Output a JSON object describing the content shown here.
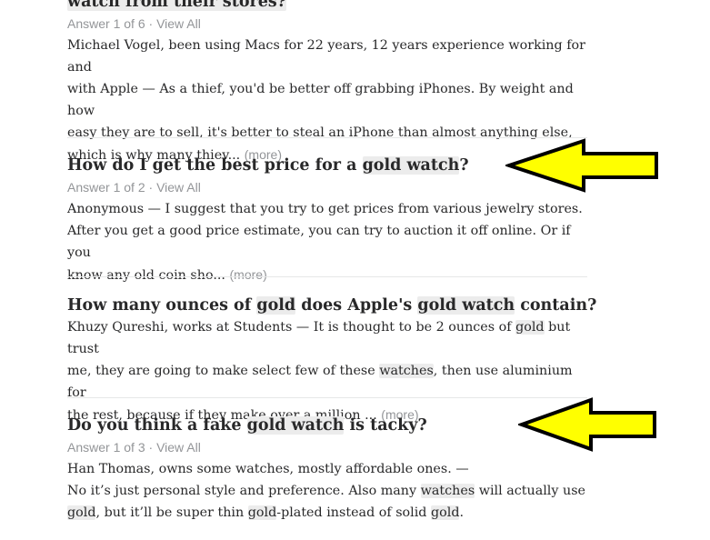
{
  "results": [
    {
      "title_tail": "watch from their stores?",
      "meta": {
        "answer": "Answer 1 of 6",
        "sep": " · ",
        "view_all": "View All"
      },
      "body": [
        "Michael Vogel, been using Macs for 22 years, 12 years experience working for and",
        "with Apple — As a thief, you'd be better off grabbing iPhones. By weight and how",
        "easy they are to sell, it's better to steal an iPhone than almost anything else,",
        "which is why many thiev..."
      ],
      "more": "(more)"
    },
    {
      "title": {
        "pre": "How do I get the best price for a ",
        "hl": "gold watch",
        "post": "?"
      },
      "meta": {
        "answer": "Answer 1 of 2",
        "sep": " · ",
        "view_all": "View All"
      },
      "body": [
        "Anonymous — I suggest that you try to get prices from various jewelry stores.",
        "After you get a good price estimate, you can try to auction it off online. Or if you",
        "know any old coin sho..."
      ],
      "more": "(more)"
    },
    {
      "title": {
        "a": "How many ounces of ",
        "hl1": "gold",
        "b": " does Apple's ",
        "hl2": "gold watch",
        "c": " contain?"
      },
      "body": {
        "l1a": "Khuzy Qureshi, works at Students — It is thought to be 2 ounces of ",
        "l1hl": "gold",
        "l1b": " but trust",
        "l2a": "me, they are going to make select few of these ",
        "l2hl": "watches",
        "l2b": ", then use aluminium for",
        "l3": "the rest, because if they make over a million ..."
      },
      "more": "(more)"
    },
    {
      "title": {
        "pre": "Do you think a fake ",
        "hl": "gold watch",
        "post": " is tacky?"
      },
      "meta": {
        "answer": "Answer 1 of 3",
        "sep": " · ",
        "view_all": "View All"
      },
      "body": {
        "l1": "Han Thomas, owns some watches, mostly affordable ones. —",
        "l2a": "No it’s just personal style and preference. Also many ",
        "l2hl": "watches",
        "l2b": " will actually use",
        "l3hl1": "gold",
        "l3a": ", but it’ll be super thin ",
        "l3hl2": "gold",
        "l3b": "-plated instead of solid ",
        "l3hl3": "gold",
        "l3c": "."
      }
    }
  ],
  "colors": {
    "arrow_fill": "#ffff00",
    "arrow_stroke": "#000000",
    "highlight": "#ececec",
    "meta_gray": "#939598"
  },
  "annotations": [
    "yellow-arrow-pointing-left",
    "yellow-arrow-pointing-left"
  ]
}
